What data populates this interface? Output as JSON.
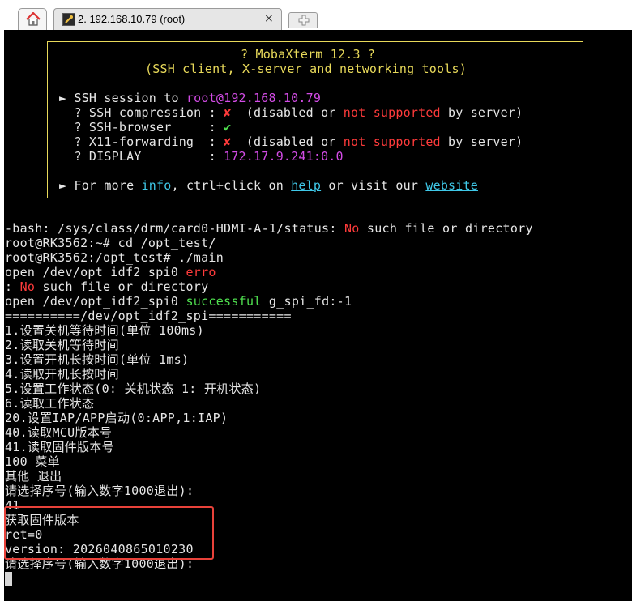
{
  "tabs": {
    "home_icon": "home-icon",
    "session_title": "2. 192.168.10.79 (root)",
    "close": "×",
    "new_tab_icon": "new-tab-icon"
  },
  "banner": {
    "title": "? MobaXterm 12.3 ?",
    "subtitle": "(SSH client, X-server and networking tools)",
    "session_prefix": "► SSH session to ",
    "session_target": "root@192.168.10.79",
    "ssh_compression_label": "  ? SSH compression : ",
    "ssh_browser_label": "  ? SSH-browser     : ",
    "x11_label": "  ? X11-forwarding  : ",
    "display_label": "  ? DISPLAY         : ",
    "cross": "✘",
    "check": "✔",
    "disabled_open": "  (disabled or ",
    "not_supported": "not supported",
    "by_server": " by server)",
    "display_value": "172.17.9.241:0.0",
    "more_prefix": "► For more ",
    "info": "info",
    "more_mid": ", ctrl+click on ",
    "help": "help",
    "more_mid2": " or visit our ",
    "website": "website"
  },
  "terminal": {
    "bash_error_prefix": "-bash: /sys/class/drm/card0-HDMI-A-1/status: ",
    "no": "No",
    "bash_error_suffix": " such file or directory",
    "cmd1": "root@RK3562:~# cd /opt_test/",
    "cmd2": "root@RK3562:/opt_test# ./main",
    "open_err_prefix": "open /dev/opt_idf2_spi0 ",
    "erro": "erro",
    "colon": ": ",
    "nosuch_suffix": " such file or directory",
    "open_ok_prefix": "open /dev/opt_idf2_spi0 ",
    "successful": "successful",
    "open_ok_suffix": " g_spi_fd:-1",
    "separator": "==========/dev/opt_idf2_spi===========",
    "menu": [
      "1.设置关机等待时间(单位 100ms)",
      "2.读取关机等待时间",
      "3.设置开机长按时间(单位 1ms)",
      "4.读取开机长按时间",
      "5.设置工作状态(0: 关机状态 1: 开机状态)",
      "6.读取工作状态",
      "20.设置IAP/APP启动(0:APP,1:IAP)",
      "40.读取MCU版本号",
      "41.读取固件版本号",
      "100 菜单",
      "其他 退出"
    ],
    "prompt": "请选择序号(输入数字1000退出):",
    "input": "41",
    "result_title": "获取固件版本",
    "ret": "ret=0",
    "version": "version: 2026040865010230",
    "prompt2": "请选择序号(输入数字1000退出):"
  },
  "colors": {
    "terminal_bg": "#000000",
    "text": "#e6e6e6",
    "magenta": "#d34ce6",
    "red": "#ff3b3b",
    "green": "#4fe04f",
    "yellow": "#e8d95a",
    "cyan": "#3fc8e8",
    "highlight_box": "#e8423a"
  }
}
